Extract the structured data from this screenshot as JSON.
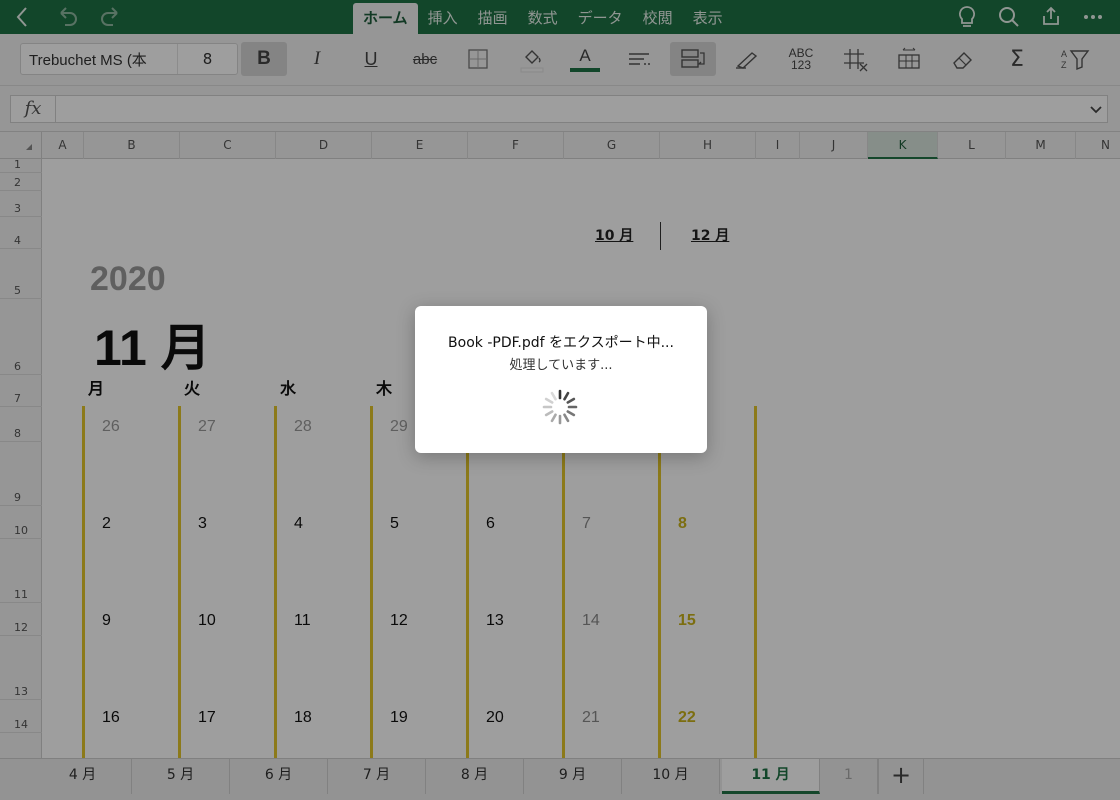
{
  "tabs": [
    {
      "label": "ホーム",
      "active": true
    },
    {
      "label": "挿入"
    },
    {
      "label": "描画"
    },
    {
      "label": "数式"
    },
    {
      "label": "データ"
    },
    {
      "label": "校閲"
    },
    {
      "label": "表示"
    }
  ],
  "ribbon": {
    "font_name": "Trebuchet MS (本",
    "font_size": "8",
    "bold_label": "B",
    "italic_label": "I",
    "underline_label": "U",
    "strike_label": "abc",
    "font_color_label": "A",
    "number_format_label_top": "ABC",
    "number_format_label_bottom": "123"
  },
  "formula_bar": {
    "label": "fx",
    "value": ""
  },
  "columns": [
    "A",
    "B",
    "C",
    "D",
    "E",
    "F",
    "G",
    "H",
    "I",
    "J",
    "K",
    "L",
    "M",
    "N"
  ],
  "selected_column": "K",
  "rows": [
    "1",
    "2",
    "3",
    "4",
    "5",
    "6",
    "7",
    "8",
    "9",
    "10",
    "11",
    "12",
    "13",
    "14"
  ],
  "calendar": {
    "prev_month_link": "10 月",
    "next_month_link": "12 月",
    "year": "2020",
    "month": "11 月",
    "weekdays": [
      "月",
      "火",
      "水",
      "木"
    ],
    "week1": [
      "26",
      "27",
      "28",
      "29"
    ],
    "week2": [
      "2",
      "3",
      "4",
      "5",
      "6",
      "7",
      "8"
    ],
    "week3": [
      "9",
      "10",
      "11",
      "12",
      "13",
      "14",
      "15"
    ],
    "week4": [
      "16",
      "17",
      "18",
      "19",
      "20",
      "21",
      "22"
    ]
  },
  "sheet_tabs": [
    {
      "label": "4 月"
    },
    {
      "label": "5 月"
    },
    {
      "label": "6 月"
    },
    {
      "label": "7 月"
    },
    {
      "label": "8 月"
    },
    {
      "label": "9 月"
    },
    {
      "label": "10 月"
    },
    {
      "label": "11 月",
      "active": true
    }
  ],
  "sheet_tab_overflow": "1",
  "add_sheet_label": "+",
  "dialog": {
    "title": "Book -PDF.pdf をエクスポート中...",
    "message": "処理しています..."
  },
  "colors": {
    "brand_green": "#1e7145",
    "accent_yellow": "#e2c62a"
  }
}
